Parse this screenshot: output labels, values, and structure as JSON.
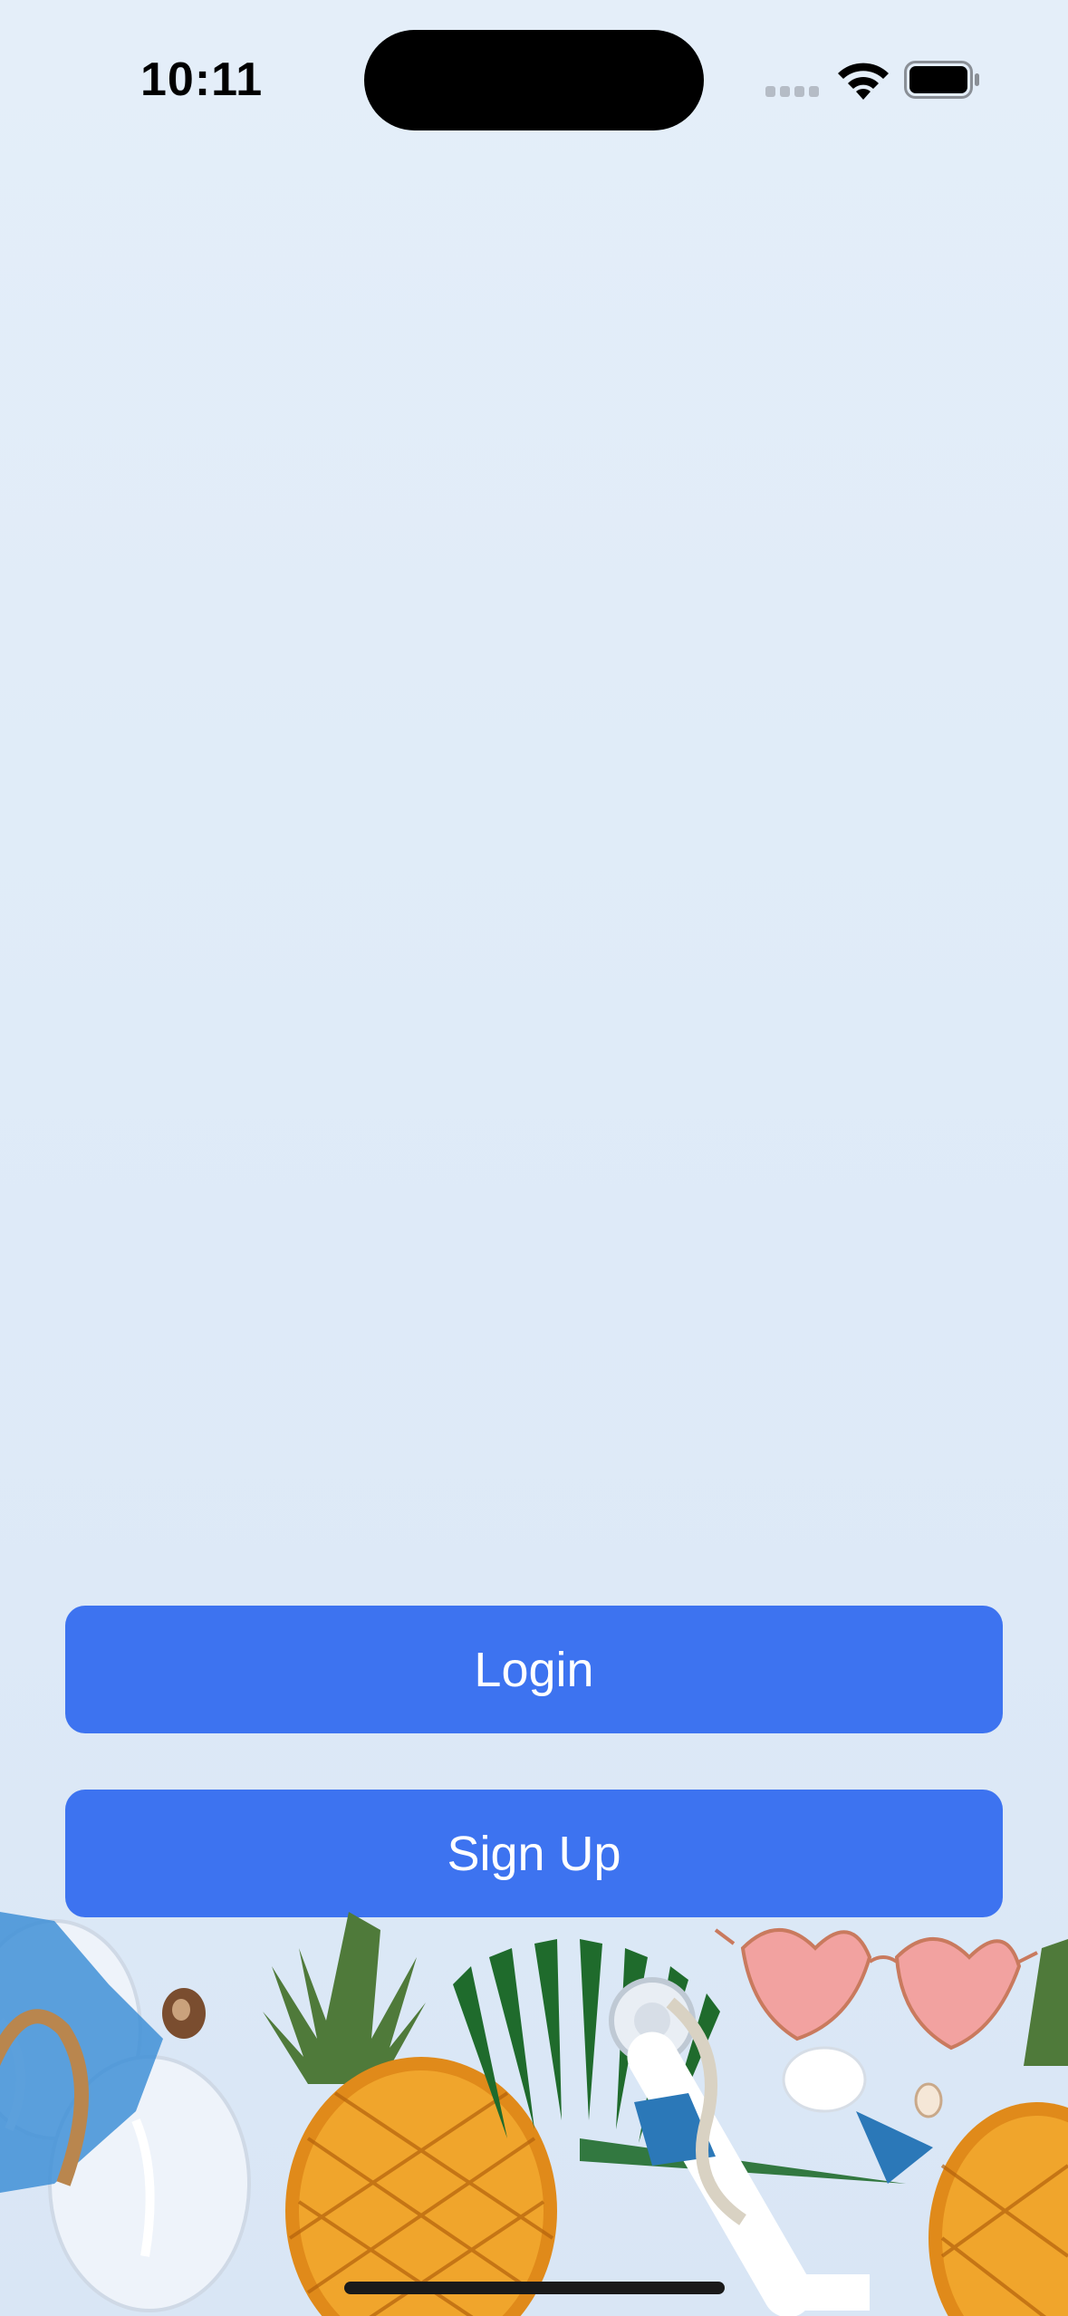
{
  "status_bar": {
    "time": "10:11",
    "signal_icon": "cellular-signal-icon",
    "wifi_icon": "wifi-icon",
    "battery_icon": "battery-icon"
  },
  "actions": {
    "login_label": "Login",
    "signup_label": "Sign Up"
  },
  "colors": {
    "background": "#e2edf9",
    "button": "#3d73f0",
    "button_text": "#ffffff"
  }
}
